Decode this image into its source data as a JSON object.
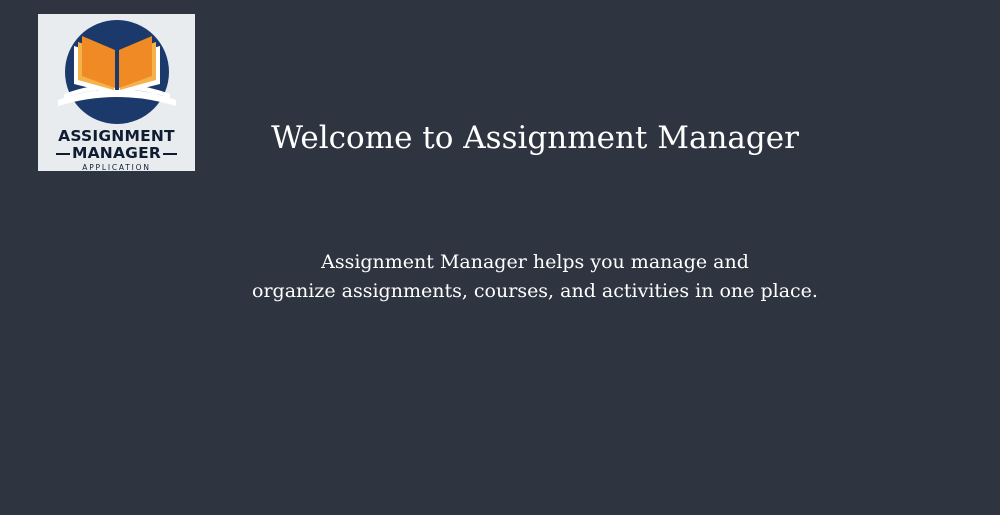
{
  "logo": {
    "line1": "ASSIGNMENT",
    "line2": "MANAGER",
    "line3": "APPLICATION",
    "colors": {
      "navy": "#1b3a6b",
      "orange": "#f08a24",
      "light_orange": "#f6b24a",
      "background": "#e9ecef"
    }
  },
  "welcome": {
    "title": "Welcome to Assignment Manager",
    "description_line1": "Assignment Manager helps you manage and",
    "description_line2": "organize assignments, courses, and activities in one place."
  },
  "colors": {
    "page_background": "#2e3440",
    "text": "#ffffff"
  }
}
